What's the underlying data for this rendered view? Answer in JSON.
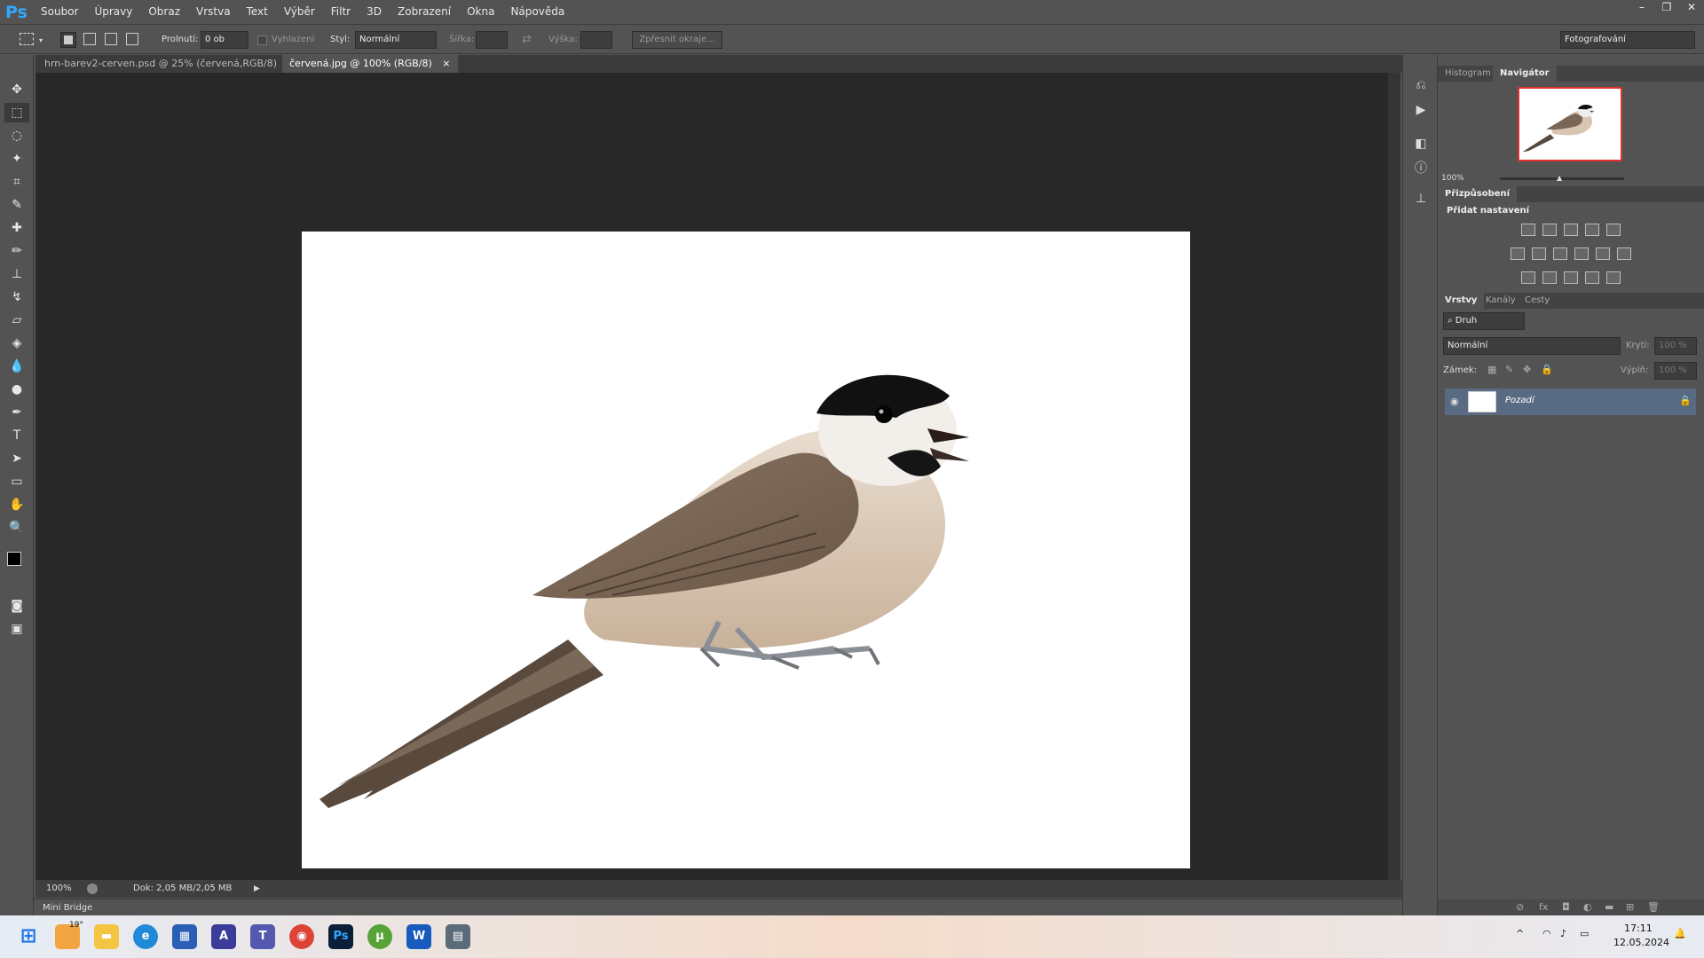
{
  "app": {
    "logo": "Ps"
  },
  "menu": [
    "Soubor",
    "Úpravy",
    "Obraz",
    "Vrstva",
    "Text",
    "Výběr",
    "Filtr",
    "3D",
    "Zobrazení",
    "Okna",
    "Nápověda"
  ],
  "window_controls": {
    "minimize": "–",
    "restore": "❐",
    "close": "✕"
  },
  "options": {
    "feather_label": "Prolnutí:",
    "feather_value": "0 ob",
    "antialias_label": "Vyhlazení",
    "style_label": "Styl:",
    "style_value": "Normální",
    "width_label": "Šířka:",
    "height_label": "Výška:",
    "refine_button": "Zpřesnit okraje...",
    "workspace": "Fotografování"
  },
  "tabs": [
    {
      "label": "hrn-barev2-cerven.psd @ 25% (červená,RGB/8)"
    },
    {
      "label": "červená.jpg @ 100% (RGB/8)"
    }
  ],
  "status": {
    "zoom": "100%",
    "doc": "Dok: 2,05 MB/2,05 MB"
  },
  "mini_bridge": "Mini Bridge",
  "panels": {
    "nav_tabs": [
      "Histogram",
      "Navigátor"
    ],
    "nav_zoom": "100%",
    "adjust_title": "Přizpůsobení",
    "adjust_subtitle": "Přidat nastavení",
    "layers_tabs": [
      "Vrstvy",
      "Kanály",
      "Cesty"
    ],
    "kind_filter": "Druh",
    "blend_mode": "Normální",
    "opacity_label": "Krytí:",
    "opacity_value": "100 %",
    "lock_label": "Zámek:",
    "fill_label": "Výplň:",
    "fill_value": "100 %",
    "layer_name": "Pozadí"
  },
  "taskbar": {
    "weather": "19°",
    "time": "17:11",
    "date": "12.05.2024",
    "apps": [
      "start-icon",
      "weather-icon",
      "file-explorer-icon",
      "edge-icon",
      "store-icon",
      "affinity-icon",
      "teams-icon",
      "chrome-icon",
      "photoshop-icon",
      "utorrent-icon",
      "word-icon",
      "calculator-icon"
    ]
  },
  "colors": {
    "ps_blue": "#33a8ff",
    "selection_layer": "#596b82",
    "canvas": "#ffffff",
    "workspace_dark": "#282828"
  }
}
